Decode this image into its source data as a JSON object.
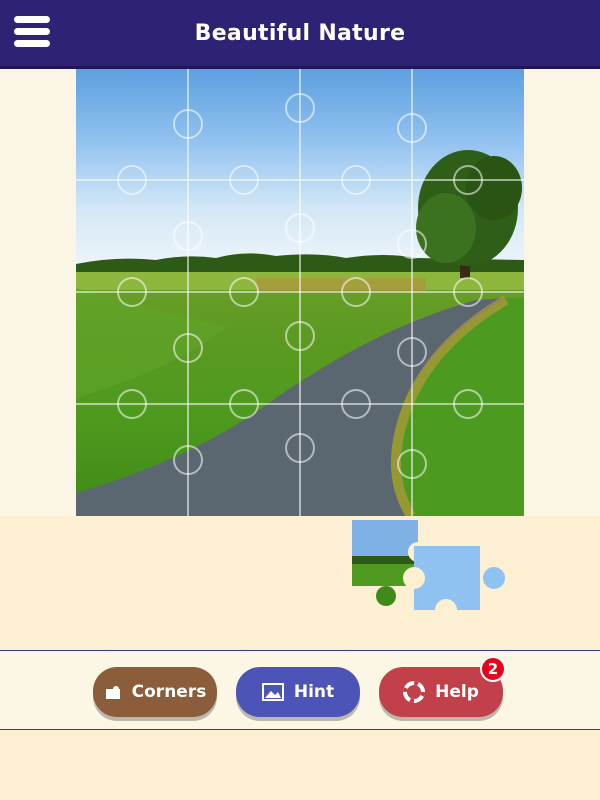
{
  "header": {
    "title": "Beautiful Nature",
    "menu_icon": "hamburger-menu-icon"
  },
  "puzzle": {
    "grid_columns": 4,
    "grid_rows": 4,
    "placed_pieces": 16,
    "loose_pieces_in_tray": 2
  },
  "toolbar": {
    "corners_label": "Corners",
    "hint_label": "Hint",
    "help_label": "Help",
    "help_badge": "2",
    "corners_icon": "puzzle-corner-icon",
    "hint_icon": "picture-icon",
    "help_icon": "lifebuoy-icon"
  },
  "colors": {
    "header_bg": "#2e2275",
    "corners_button": "#8b5d3b",
    "hint_button": "#4c54b8",
    "help_button": "#c2404a",
    "badge": "#e8001c"
  }
}
